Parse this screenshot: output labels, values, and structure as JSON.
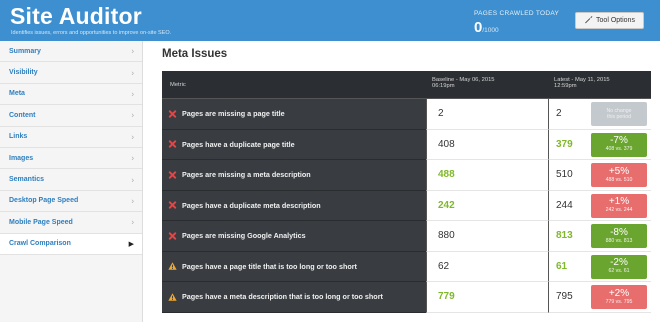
{
  "header": {
    "title": "Site Auditor",
    "subtitle": "Identifies issues, errors and opportunities to improve on-site SEO.",
    "pages_crawled_label": "PAGES CRAWLED TODAY",
    "pages_crawled_value": "0",
    "pages_crawled_max": "/1000",
    "tool_options_label": "Tool Options"
  },
  "sidebar": {
    "items": [
      {
        "label": "Summary"
      },
      {
        "label": "Visibility"
      },
      {
        "label": "Meta"
      },
      {
        "label": "Content"
      },
      {
        "label": "Links"
      },
      {
        "label": "Images"
      },
      {
        "label": "Semantics"
      },
      {
        "label": "Desktop Page Speed"
      },
      {
        "label": "Mobile Page Speed"
      },
      {
        "label": "Crawl Comparison"
      }
    ],
    "active_index": 9
  },
  "main": {
    "section_title": "Meta Issues",
    "table": {
      "col_metric": "Metric",
      "col_baseline_line1": "Baseline - May 06, 2015",
      "col_baseline_line2": "06:19pm",
      "col_latest_line1": "Latest - May 11, 2015",
      "col_latest_line2": "12:59pm",
      "rows": [
        {
          "icon": "x-icon",
          "metric": "Pages are missing a page title",
          "baseline": "2",
          "latest": "2",
          "change": "No change",
          "change_sub": "this period",
          "status": "gray"
        },
        {
          "icon": "x-icon",
          "metric": "Pages have a duplicate page title",
          "baseline": "408",
          "latest": "379",
          "change": "-7%",
          "change_sub": "408 vs. 379",
          "status": "green"
        },
        {
          "icon": "x-icon",
          "metric": "Pages are missing a meta description",
          "baseline": "488",
          "latest": "510",
          "change": "+5%",
          "change_sub": "488 vs. 510",
          "status": "red"
        },
        {
          "icon": "x-icon",
          "metric": "Pages have a duplicate meta description",
          "baseline": "242",
          "latest": "244",
          "change": "+1%",
          "change_sub": "242 vs. 244",
          "status": "red"
        },
        {
          "icon": "x-icon",
          "metric": "Pages are missing Google Analytics",
          "baseline": "880",
          "latest": "813",
          "change": "-8%",
          "change_sub": "880 vs. 813",
          "status": "green"
        },
        {
          "icon": "warning-icon",
          "metric": "Pages have a page title that is too long or too short",
          "baseline": "62",
          "latest": "61",
          "change": "-2%",
          "change_sub": "62 vs. 61",
          "status": "green"
        },
        {
          "icon": "warning-icon",
          "metric": "Pages have a meta description that is too long or too short",
          "baseline": "779",
          "latest": "795",
          "change": "+2%",
          "change_sub": "779 vs. 795",
          "status": "red"
        }
      ]
    }
  },
  "colors": {
    "header_bg": "#3d8fcf",
    "table_dark": "#393d41",
    "good": "#7fb82a",
    "badge_green": "#6aa52f",
    "badge_red": "#e86e6e",
    "badge_gray": "#c4c9cd",
    "x_icon": "#e64545",
    "warning_icon": "#f0a830"
  }
}
